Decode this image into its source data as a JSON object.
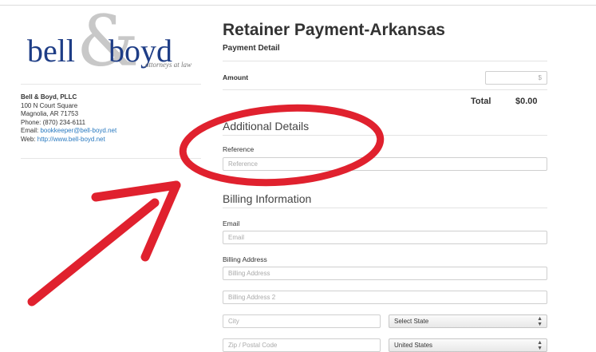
{
  "firm": {
    "logo_word1": "bell",
    "logo_amp": "&",
    "logo_word2": "boyd",
    "logo_tagline": "attorneys at law",
    "name": "Bell & Boyd, PLLC",
    "address1": "100 N Court Square",
    "address2": "Magnolia, AR 71753",
    "phone": "Phone: (870) 234-6111",
    "email_label": "Email: ",
    "email": "bookkeeper@bell-boyd.net",
    "web_label": "Web: ",
    "web": "http://www.bell-boyd.net"
  },
  "form": {
    "title": "Retainer Payment-Arkansas",
    "subtitle": "Payment Detail",
    "amount_label": "Amount",
    "amount_placeholder": "$",
    "total_label": "Total",
    "total_value": "$0.00",
    "additional_heading": "Additional Details",
    "reference_label": "Reference",
    "reference_placeholder": "Reference",
    "billing_heading": "Billing Information",
    "email_label": "Email",
    "email_placeholder": "Email",
    "billing_address_label": "Billing Address",
    "billing_address_placeholder": "Billing Address",
    "billing_address2_placeholder": "Billing Address 2",
    "city_placeholder": "City",
    "state_select": "Select State",
    "zip_placeholder": "Zip / Postal Code",
    "country_select": "United States"
  },
  "colors": {
    "annotation_red": "#e0212e",
    "logo_blue": "#1e3d86",
    "link_blue": "#2a7ac0"
  }
}
